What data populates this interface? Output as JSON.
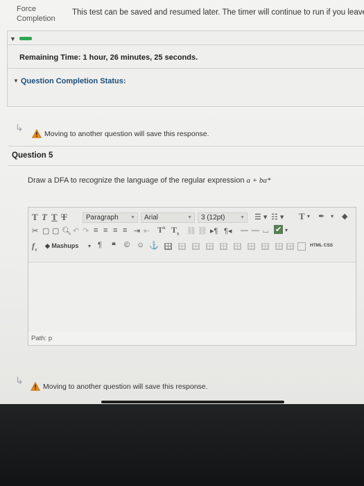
{
  "header": {
    "force_label_line1": "Force",
    "force_label_line2": "Completion",
    "force_text": "This test can be saved and resumed later. The timer will continue to run if you leave"
  },
  "timer": {
    "remaining_label": "Remaining Time:",
    "remaining_value": "1 hour, 26 minutes, 25 seconds.",
    "question_status_label": "Question Completion Status:"
  },
  "notice": {
    "text": "Moving to another question will save this response."
  },
  "question": {
    "title": "Question 5",
    "prompt_text": "Draw a DFA to recognize the language of the regular expression",
    "prompt_expr": "a + ba*"
  },
  "editor": {
    "paragraph_select": "Paragraph",
    "font_select": "Arial",
    "size_select": "3 (12pt)",
    "mashups_label": "Mashups",
    "html_label": "HTML",
    "css_label": "CSS",
    "path_label": "Path: p"
  },
  "footer_notice": {
    "text": "Moving to another question will save this response."
  },
  "colors": {
    "accent_green": "#2fa84f",
    "link_blue": "#1b4f7a",
    "warning_orange": "#e8891a"
  }
}
